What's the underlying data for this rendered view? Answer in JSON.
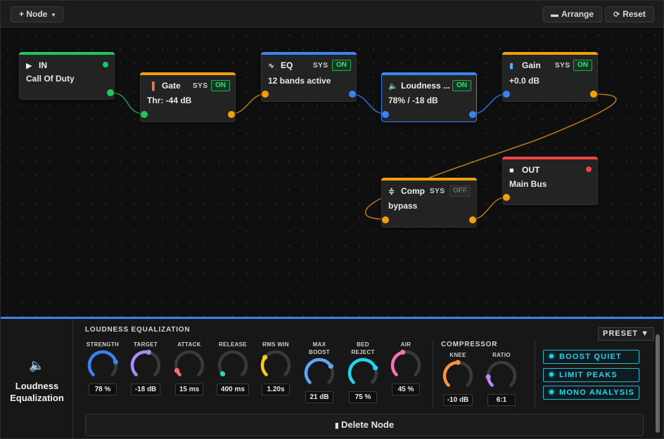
{
  "toolbar": {
    "add_node": {
      "label": "Node",
      "icon": "+",
      "caret": "▾"
    },
    "arrange": {
      "label": "Arrange",
      "icon": "▬"
    },
    "reset": {
      "label": "Reset",
      "icon": "⟳"
    }
  },
  "nodes": {
    "in": {
      "title": "IN",
      "subtitle": "Call Of Duty",
      "icon": "play-icon",
      "accent": "#22c55e"
    },
    "gate": {
      "title": "Gate",
      "subtitle": "Thr: -44 dB",
      "sys": "SYS",
      "state": "ON",
      "icon": "gate-icon",
      "accent": "#f59e0b"
    },
    "eq": {
      "title": "EQ",
      "subtitle": "12 bands active",
      "sys": "SYS",
      "state": "ON",
      "icon": "wave-icon",
      "accent": "#3b82f6"
    },
    "loudness": {
      "title": "Loudness ...",
      "subtitle": "78% / -18 dB",
      "state": "ON",
      "icon": "speaker-icon",
      "accent": "#3b82f6"
    },
    "gain": {
      "title": "Gain",
      "subtitle": "+0.0 dB",
      "sys": "SYS",
      "state": "ON",
      "icon": "bar-chart-icon",
      "accent": "#f59e0b"
    },
    "comp": {
      "title": "Comp",
      "subtitle": "bypass",
      "sys": "SYS",
      "state": "OFF",
      "icon": "compress-icon",
      "accent": "#f59e0b"
    },
    "out": {
      "title": "OUT",
      "subtitle": "Main Bus",
      "icon": "stop-icon",
      "accent": "#ef4444"
    }
  },
  "panel": {
    "title_line1": "Loudness",
    "title_line2": "Equalization",
    "icon": "speaker-icon",
    "section_loudness": "LOUDNESS EQUALIZATION",
    "section_compressor": "COMPRESSOR",
    "preset_label": "PRESET ▼",
    "delete_label": "Delete Node",
    "knobs": [
      {
        "label": "STRENGTH",
        "value": "78 %",
        "color": "#3b82f6",
        "level": 0.78
      },
      {
        "label": "TARGET",
        "value": "-18 dB",
        "color": "#a78bfa",
        "level": 0.55
      },
      {
        "label": "ATTACK",
        "value": "15 ms",
        "color": "#f87171",
        "level": 0.08
      },
      {
        "label": "RELEASE",
        "value": "400 ms",
        "color": "#2dd4bf",
        "level": 0.02
      },
      {
        "label": "RMS WIN",
        "value": "1.20s",
        "color": "#facc15",
        "level": 0.3
      },
      {
        "label": "MAX BOOST",
        "value": "21 dB",
        "color": "#60a5fa",
        "level": 0.72
      },
      {
        "label": "BED REJECT",
        "value": "75 %",
        "color": "#22d3ee",
        "level": 0.75
      },
      {
        "label": "AIR",
        "value": "45 %",
        "color": "#f472b6",
        "level": 0.45
      }
    ],
    "comp_knobs": [
      {
        "label": "KNEE",
        "value": "-10 dB",
        "color": "#fb923c",
        "level": 0.5
      },
      {
        "label": "RATIO",
        "value": "6:1",
        "color": "#c084fc",
        "level": 0.15
      }
    ],
    "modes": [
      "BOOST QUIET",
      "LIMIT PEAKS",
      "MONO ANALYSIS"
    ]
  }
}
